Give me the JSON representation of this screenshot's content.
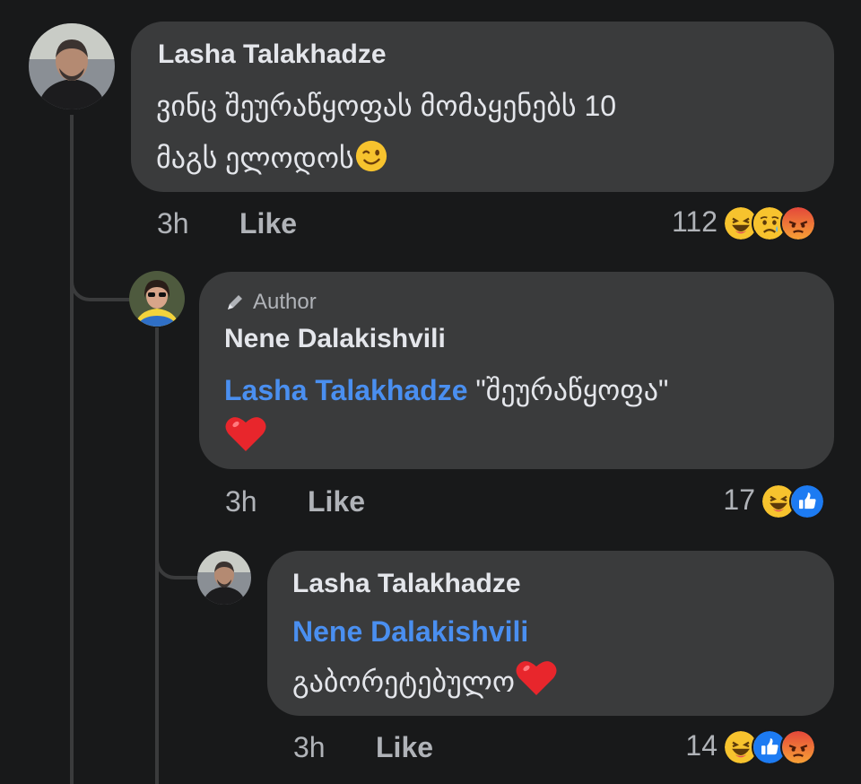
{
  "comment": {
    "author": "Lasha Talakhadze",
    "line1": "ვინც შეურაწყოფას მომაყენებს  10",
    "line2": "მაგს ელოდოს",
    "time": "3h",
    "like_label": "Like",
    "reaction_count": "112",
    "reactions": [
      "haha-icon",
      "sad-icon",
      "angry-icon"
    ]
  },
  "reply1": {
    "badge": "Author",
    "author": "Nene Dalakishvili",
    "mention": "Lasha Talakhadze",
    "text": " \"შეურაწყოფა\"",
    "time": "3h",
    "like_label": "Like",
    "reaction_count": "17",
    "reactions": [
      "haha-icon",
      "like-icon"
    ]
  },
  "reply2": {
    "author": "Lasha Talakhadze",
    "mention": "Nene Dalakishvili",
    "text": "გაბორეტებულო",
    "time": "3h",
    "like_label": "Like",
    "reaction_count": "14",
    "reactions": [
      "haha-icon",
      "like-icon",
      "angry-icon"
    ]
  },
  "colors": {
    "background": "#18191a",
    "bubble": "#3a3b3c",
    "text_primary": "#e4e6eb",
    "text_secondary": "#b0b3b8",
    "mention": "#4a8ff0"
  }
}
